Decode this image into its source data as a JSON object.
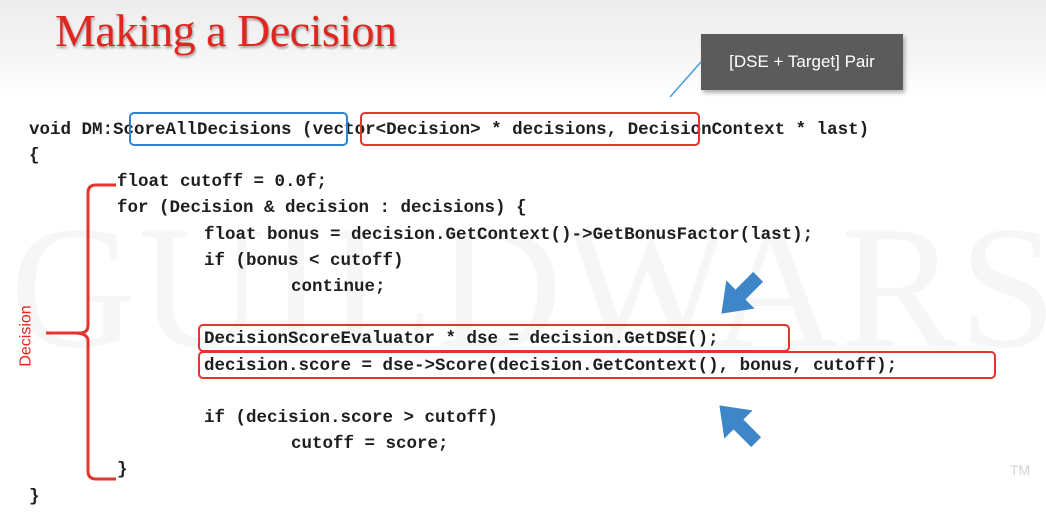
{
  "slide": {
    "title": "Making a Decision",
    "callout": "[DSE + Target] Pair",
    "side_label": "Decision",
    "watermark": "GUILDWARS",
    "trademark": "TM",
    "code": {
      "sig_1": "void DM:",
      "sig_2": "ScoreAllDecisions",
      "sig_3": " (",
      "sig_4": "vector<Decision> * decisions",
      "sig_5": ", DecisionContext * last)",
      "line_2": "{",
      "line_3": "float cutoff = 0.0f;",
      "line_4": "for (Decision & decision : decisions) {",
      "line_5": "float bonus = decision.GetContext()->GetBonusFactor(last);",
      "line_6": "if (bonus < cutoff)",
      "line_7": "continue;",
      "line_8": "DecisionScoreEvaluator * dse = decision.GetDSE();",
      "line_9": "decision.score = dse->Score(decision.GetContext(), bonus, cutoff);",
      "line_10": "if (decision.score > cutoff)",
      "line_11": "cutoff = score;",
      "line_12": "}",
      "line_13": "}"
    },
    "colors": {
      "title": "#e0261f",
      "highlight_red": "#e3342f",
      "highlight_blue": "#2e84d3",
      "arrow_blue": "#3f86c9",
      "callout_bg": "#5b5b5b"
    },
    "icons": [
      "arrow-down-left-icon",
      "arrow-up-left-icon",
      "curly-brace-icon"
    ]
  }
}
